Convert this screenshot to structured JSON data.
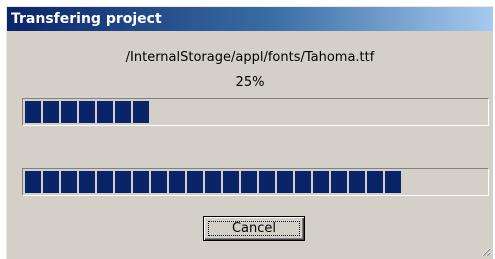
{
  "dialog": {
    "title": "Transfering project",
    "file_path": "/InternalStorage/appl/fonts/Tahoma.ttf",
    "percent_text": "25%",
    "file_progress": 0.26,
    "total_progress": 0.84,
    "cancel_label": "Cancel"
  },
  "colors": {
    "progress_block": "#0a246a",
    "title_gradient_start": "#0a246a",
    "title_gradient_end": "#a6caf0",
    "dialog_face": "#d4d0c8"
  },
  "icons": {
    "resize_grip": "size-grip-icon"
  }
}
